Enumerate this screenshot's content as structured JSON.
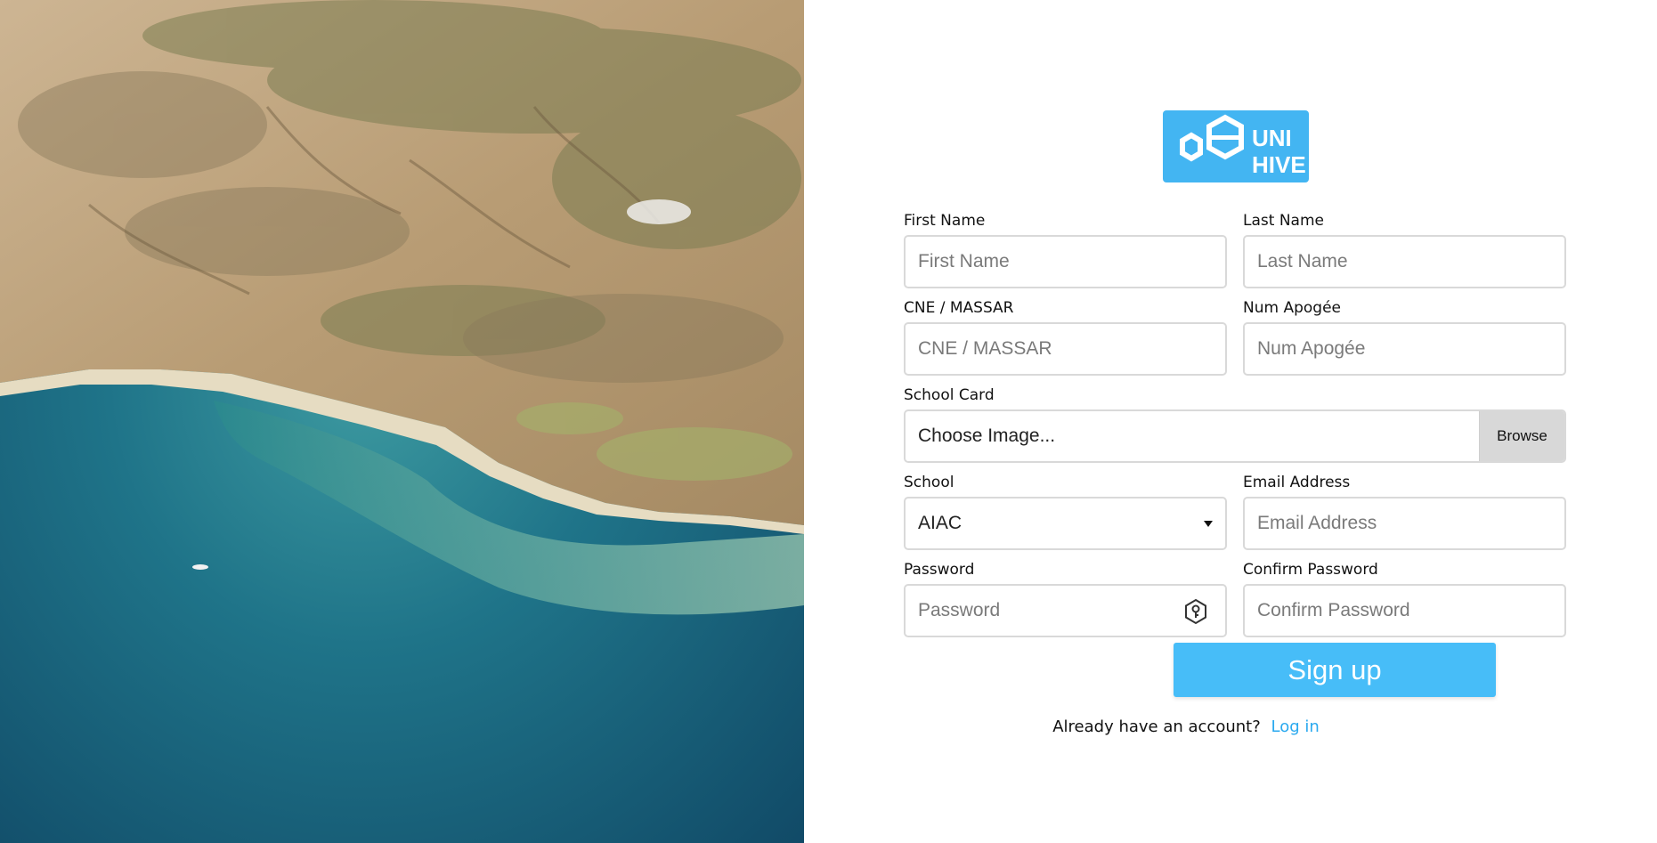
{
  "brand": {
    "logo_text_line1": "UNI",
    "logo_text_line2": "HIVE",
    "logo_color": "#43b5f2"
  },
  "form": {
    "first_name": {
      "label": "First Name",
      "placeholder": "First Name",
      "value": ""
    },
    "last_name": {
      "label": "Last Name",
      "placeholder": "Last Name",
      "value": ""
    },
    "cne": {
      "label": "CNE / MASSAR",
      "placeholder": "CNE / MASSAR",
      "value": ""
    },
    "apogee": {
      "label": "Num Apogée",
      "placeholder": "Num Apogée",
      "value": ""
    },
    "school_card": {
      "label": "School Card",
      "file_text": "Choose Image...",
      "browse_label": "Browse"
    },
    "school": {
      "label": "School",
      "selected": "AIAC"
    },
    "email": {
      "label": "Email Address",
      "placeholder": "Email Address",
      "value": ""
    },
    "password": {
      "label": "Password",
      "placeholder": "Password",
      "value": ""
    },
    "confirm_password": {
      "label": "Confirm Password",
      "placeholder": "Confirm Password",
      "value": ""
    }
  },
  "actions": {
    "signup_label": "Sign up",
    "signup_color": "#47bdf8",
    "footer_text": "Already have an account?",
    "login_link": "Log in",
    "link_color": "#2aa9ef"
  },
  "icons": {
    "password_toggle": "key-hexagon-icon",
    "select_caret": "caret-down-icon"
  }
}
